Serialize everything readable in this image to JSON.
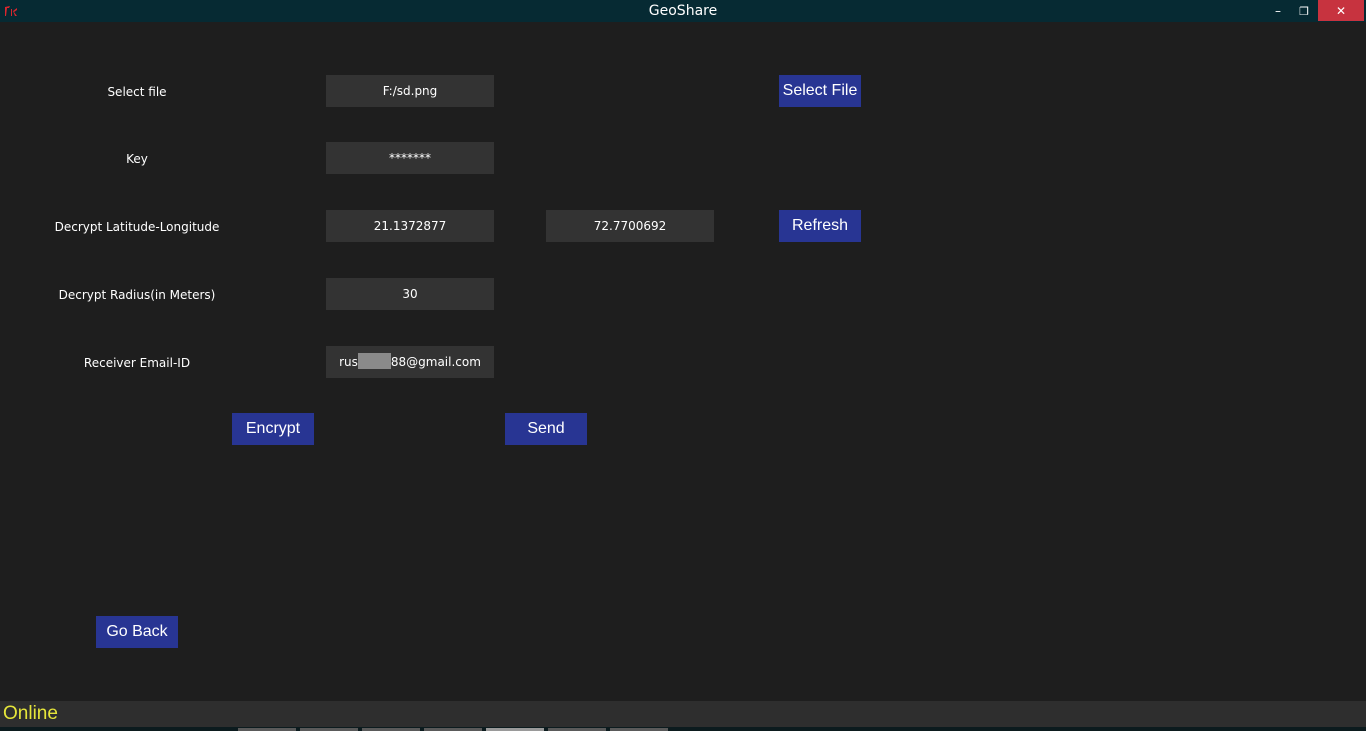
{
  "window": {
    "title": "GeoShare",
    "min_glyph": "–",
    "max_glyph": "❐",
    "close_glyph": "✕"
  },
  "form": {
    "file_label": "Select file",
    "file_value": "F:/sd.png",
    "select_file_button": "Select File",
    "key_label": "Key",
    "key_value": "*******",
    "latlon_label": "Decrypt Latitude-Longitude",
    "latitude_value": "21.1372877",
    "longitude_value": "72.7700692",
    "refresh_button": "Refresh",
    "radius_label": "Decrypt Radius(in Meters)",
    "radius_value": "30",
    "email_label": "Receiver Email-ID",
    "email_prefix": "rus",
    "email_suffix": "88@gmail.com",
    "encrypt_button": "Encrypt",
    "send_button": "Send",
    "go_back_button": "Go Back"
  },
  "status": {
    "text": "Online",
    "color": "#e5e53a"
  },
  "colors": {
    "titlebar": "#062a33",
    "background": "#1e1e1e",
    "field": "#333333",
    "button": "#283593",
    "close_button": "#c7333f"
  }
}
